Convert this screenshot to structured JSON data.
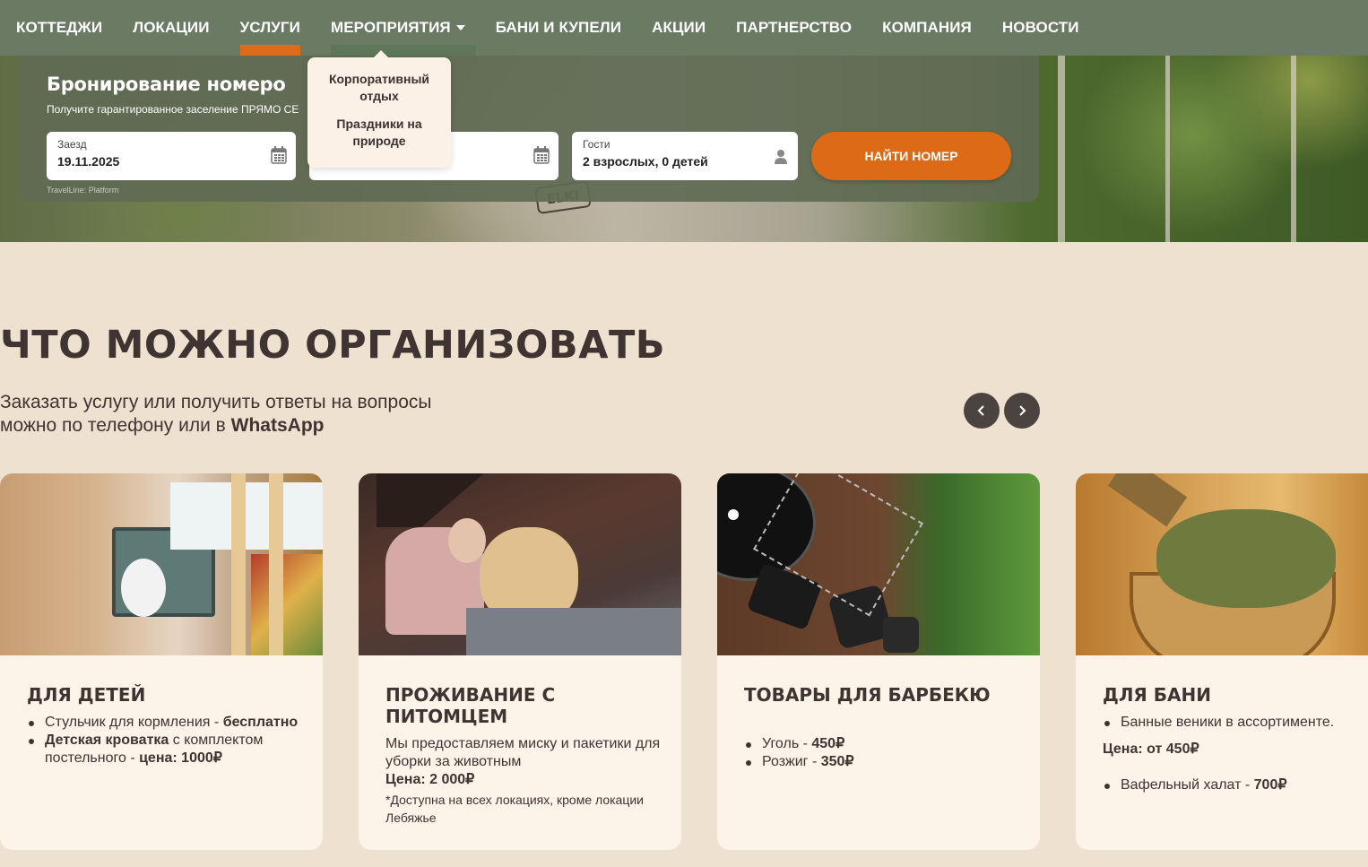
{
  "nav": {
    "items": [
      {
        "label": "КОТТЕДЖИ"
      },
      {
        "label": "ЛОКАЦИИ"
      },
      {
        "label": "УСЛУГИ"
      },
      {
        "label": "МЕРОПРИЯТИЯ"
      },
      {
        "label": "БАНИ И КУПЕЛИ"
      },
      {
        "label": "АКЦИИ"
      },
      {
        "label": "ПАРТНЕРСТВО"
      },
      {
        "label": "КОМПАНИЯ"
      },
      {
        "label": "НОВОСТИ"
      }
    ],
    "active_index": 2,
    "dropdown_open_index": 3
  },
  "dropdown": {
    "items": [
      "Корпоративный отдых",
      "Праздники на природе"
    ]
  },
  "booking": {
    "title": "Бронирование номеро",
    "subtitle": "Получите гарантированное заселение ПРЯМО СЕ",
    "checkin_label": "Заезд",
    "checkin_value": "19.11.2025",
    "guests_label": "Гости",
    "guests_value": "2 взрослых, 0 детей",
    "find_button": "НАЙТИ НОМЕР",
    "platform": "TravelLine: Platform"
  },
  "hero": {
    "stamp_text": "ELKI"
  },
  "section": {
    "title": "ЧТО МОЖНО ОРГАНИЗОВАТЬ",
    "sub_line1": "Заказать услугу или получить ответы на вопросы",
    "sub_line2": "можно по телефону или в ",
    "sub_bold": "WhatsApp"
  },
  "cards": [
    {
      "title": "ДЛЯ ДЕТЕЙ",
      "b1_text": "Стульчик для кормления - ",
      "b1_bold": "бесплатно",
      "b2_bold": "Детская кроватка",
      "b2_text": " с комплектом постельного - ",
      "b2_price": "цена: 1000₽"
    },
    {
      "title": "ПРОЖИВАНИЕ С ПИТОМЦЕМ",
      "text": "Мы предоставляем миску и пакетики для уборки за животным",
      "price": "Цена: 2 000₽",
      "note": "*Доступна на всех локациях, кроме локации Лебяжье"
    },
    {
      "title": "ТОВАРЫ ДЛЯ БАРБЕКЮ",
      "b1_text": "Уголь - ",
      "b1_bold": "450₽",
      "b2_text": "Розжиг - ",
      "b2_bold": "350₽"
    },
    {
      "title": "ДЛЯ БАНИ",
      "b1_text": "Банные веники в ассортименте.",
      "price": "Цена: от 450₽",
      "b2_text": "Вафельный халат - ",
      "b2_bold": "700₽"
    }
  ],
  "colors": {
    "nav_bg": "#6b7a63",
    "accent": "#dc6a16",
    "page_bg": "#efe1cf",
    "card_bg": "#fcf3e9",
    "text_dark": "#403432"
  }
}
